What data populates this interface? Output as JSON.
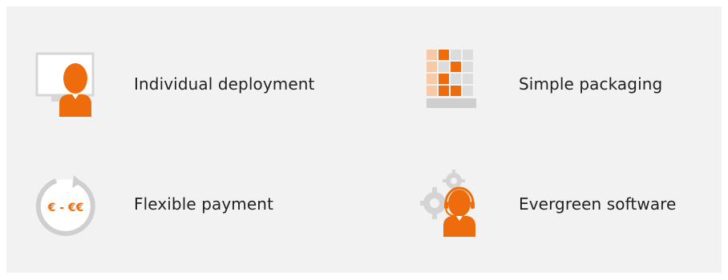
{
  "features": [
    {
      "label": "Individual deployment",
      "icon": "monitor-user-icon"
    },
    {
      "label": "Simple packaging",
      "icon": "package-grid-icon"
    },
    {
      "label": "Flexible payment",
      "icon": "payment-cycle-icon",
      "icon_text": "€ - €€"
    },
    {
      "label": "Evergreen software",
      "icon": "support-gears-icon"
    }
  ],
  "colors": {
    "panel_background": "#f2f2f2",
    "accent": "#ee6c0c",
    "light_accent": "#f7c9a7",
    "gray": "#d9d9d9",
    "text": "#222222"
  }
}
